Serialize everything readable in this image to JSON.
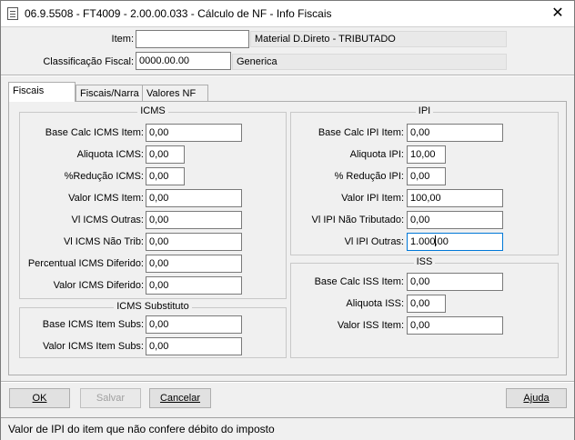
{
  "window": {
    "title": "06.9.5508 - FT4009 - 2.00.00.033 - Cálculo de NF - Info Fiscais",
    "close_glyph": "✕"
  },
  "header": {
    "item_label": "Item:",
    "item_value": "",
    "item_desc": "Material D.Direto - TRIBUTADO",
    "classificacao_label": "Classificação Fiscal:",
    "classificacao_value": "0000.00.00",
    "classificacao_desc": "Generica"
  },
  "tabs": [
    {
      "label": "Fiscais",
      "active": true
    },
    {
      "label": "Fiscais/Narra",
      "active": false
    },
    {
      "label": "Valores NF",
      "active": false
    }
  ],
  "icms": {
    "title": "ICMS",
    "fields": [
      {
        "label": "Base Calc ICMS Item:",
        "value": "0,00"
      },
      {
        "label": "Aliquota ICMS:",
        "value": "0,00"
      },
      {
        "label": "%Redução ICMS:",
        "value": "0,00"
      },
      {
        "label": "Valor ICMS Item:",
        "value": "0,00"
      },
      {
        "label": "Vl ICMS Outras:",
        "value": "0,00"
      },
      {
        "label": "Vl ICMS Não Trib:",
        "value": "0,00"
      },
      {
        "label": "Percentual ICMS Diferido:",
        "value": "0,00"
      },
      {
        "label": "Valor ICMS Diferido:",
        "value": "0,00"
      }
    ]
  },
  "icms_st": {
    "title": "ICMS Substituto",
    "fields": [
      {
        "label": "Base ICMS Item Subs:",
        "value": "0,00"
      },
      {
        "label": "Valor ICMS Item Subs:",
        "value": "0,00"
      }
    ]
  },
  "ipi": {
    "title": "IPI",
    "fields": [
      {
        "label": "Base Calc IPI Item:",
        "value": "0,00"
      },
      {
        "label": "Aliquota IPI:",
        "value": "10,00"
      },
      {
        "label": "% Redução IPI:",
        "value": "0,00"
      },
      {
        "label": "Valor IPI Item:",
        "value": "100,00"
      },
      {
        "label": "Vl IPI Não Tributado:",
        "value": "0,00"
      },
      {
        "label": "Vl IPI Outras:",
        "value_before_cursor": "1.000",
        "value_after_cursor": ",00"
      }
    ]
  },
  "iss": {
    "title": "ISS",
    "fields": [
      {
        "label": "Base Calc ISS Item:",
        "value": "0,00"
      },
      {
        "label": "Aliquota ISS:",
        "value": "0,00"
      },
      {
        "label": "Valor ISS Item:",
        "value": "0,00"
      }
    ]
  },
  "buttons": {
    "ok": "OK",
    "salvar": "Salvar",
    "cancelar": "Cancelar",
    "ajuda": "Ajuda"
  },
  "status_text": "Valor de IPI do item que não confere débito do imposto"
}
